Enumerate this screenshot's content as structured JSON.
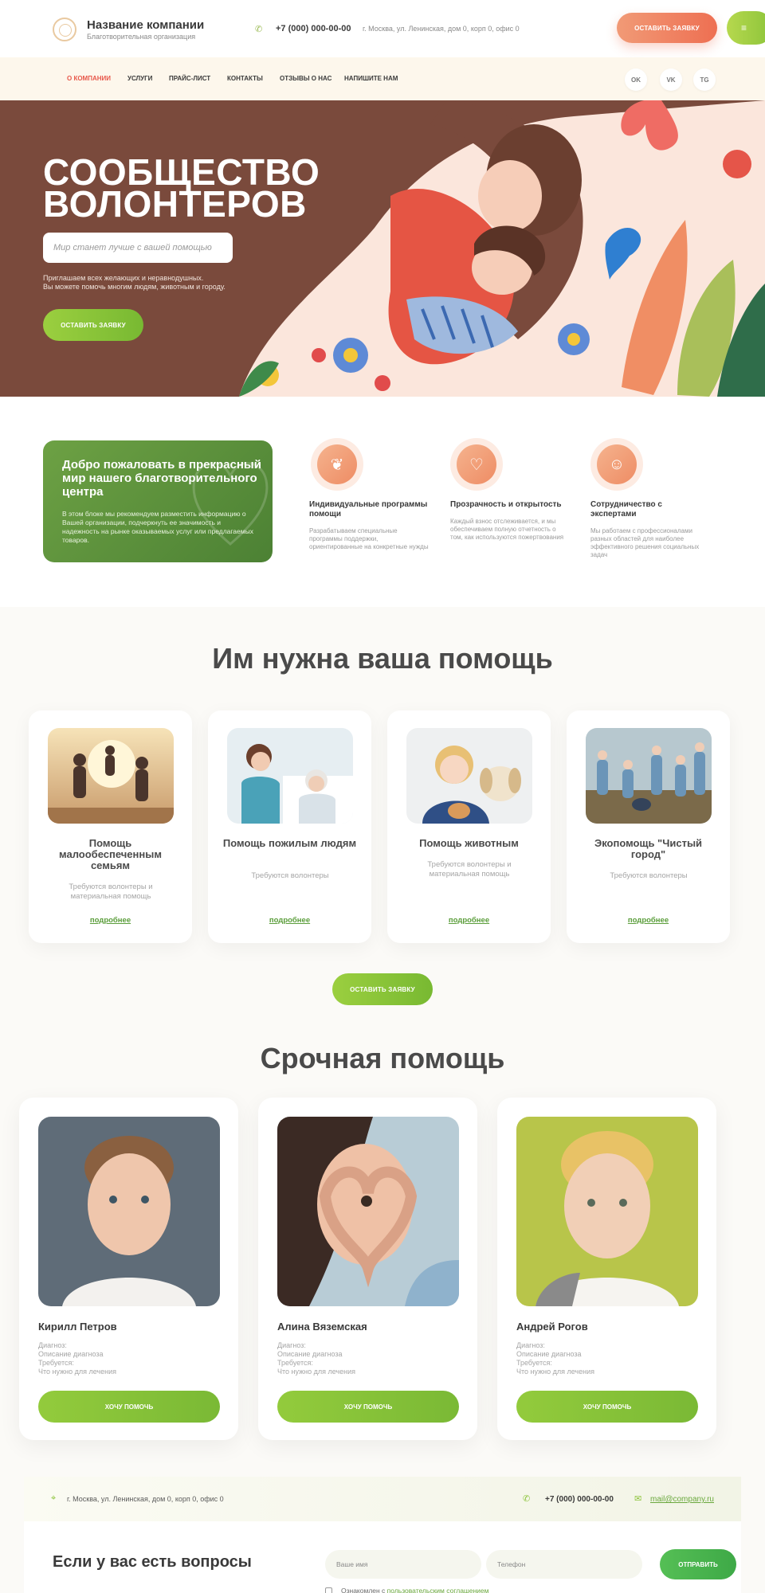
{
  "header": {
    "company_name": "Название компании",
    "company_sub": "Благотворительная организация",
    "phone": "+7 (000) 000-00-00",
    "address": "г. Москва, ул. Ленинская, дом 0, корп 0, офис 0",
    "cta": "ОСТАВИТЬ ЗАЯВКУ",
    "menu_icon": "≡"
  },
  "nav": {
    "items": [
      "О КОМПАНИИ",
      "УСЛУГИ",
      "ПРАЙС-ЛИСТ",
      "КОНТАКТЫ",
      "ОТЗЫВЫ О НАС",
      "НАПИШИТЕ НАМ"
    ],
    "social": [
      "OK",
      "VK",
      "TG"
    ]
  },
  "hero": {
    "title_line1": "СООБЩЕСТВО",
    "title_line2": "ВОЛОНТЕРОВ",
    "input_placeholder": "Мир станет лучше с вашей помощью",
    "text_line1": "Приглашаем всех желающих и неравнодушных.",
    "text_line2": "Вы можете помочь многим людям, животным и городу.",
    "cta": "ОСТАВИТЬ ЗАЯВКУ"
  },
  "welcome": {
    "title": "Добро пожаловать в прекрасный мир нашего благотворительного центра",
    "text": "В этом блоке мы рекомендуем разместить информацию о Вашей организации, подчеркнуть ее значимость и надежность на рынке оказываемых услуг или предлагаемых товаров."
  },
  "features": [
    {
      "icon": "hands-heart-icon",
      "title": "Индивидуальные программы помощи",
      "text": "Разрабатываем специальные программы поддержки, ориентированные на конкретные нужды"
    },
    {
      "icon": "handshake-icon",
      "title": "Прозрачность и открытость",
      "text": "Каждый взнос отслеживается, и мы обеспечиваем полную отчетность о том, как используются пожертвования"
    },
    {
      "icon": "team-icon",
      "title": "Сотрудничество с экспертами",
      "text": "Мы работаем с профессионалами разных областей для наиболее эффективного решения социальных задач"
    }
  ],
  "help": {
    "title": "Им нужна ваша помощь",
    "cards": [
      {
        "title": "Помощь малообеспеченным семьям",
        "sub": "Требуются волонтеры и материальная помощь",
        "link": "подробнее"
      },
      {
        "title": "Помощь пожилым людям",
        "sub": "Требуются волонтеры",
        "link": "подробнее"
      },
      {
        "title": "Помощь животным",
        "sub": "Требуются волонтеры и материальная помощь",
        "link": "подробнее"
      },
      {
        "title": "Экопомощь \"Чистый город\"",
        "sub": "Требуются волонтеры",
        "link": "подробнее"
      }
    ],
    "cta": "ОСТАВИТЬ ЗАЯВКУ"
  },
  "urgent": {
    "title": "Срочная помощь",
    "cards": [
      {
        "name": "Кирилл Петров",
        "l1": "Диагноз:",
        "l2": "Описание диагноза",
        "l3": "Требуется:",
        "l4": "Что нужно для лечения",
        "btn": "ХОЧУ ПОМОЧЬ"
      },
      {
        "name": "Алина Вяземская",
        "l1": "Диагноз:",
        "l2": "Описание диагноза",
        "l3": "Требуется:",
        "l4": "Что нужно для лечения",
        "btn": "ХОЧУ ПОМОЧЬ"
      },
      {
        "name": "Андрей Рогов",
        "l1": "Диагноз:",
        "l2": "Описание диагноза",
        "l3": "Требуется:",
        "l4": "Что нужно для лечения",
        "btn": "ХОЧУ ПОМОЧЬ"
      }
    ]
  },
  "footer": {
    "address": "г. Москва, ул. Ленинская, дом 0, корп 0, офис 0",
    "phone": "+7 (000) 000-00-00",
    "email": "mail@company.ru",
    "question_title": "Если у вас есть вопросы",
    "name_placeholder": "Ваше имя",
    "phone_placeholder": "Телефон",
    "submit": "ОТПРАВИТЬ",
    "agree_prefix": "Ознакомлен с ",
    "agree_link": "пользовательским соглашением"
  },
  "colors": {
    "accent_green": "#8cc43a",
    "accent_orange": "#ee6f52",
    "hero_brown": "#7a4a3c",
    "welcome_green": "#5a9140"
  }
}
